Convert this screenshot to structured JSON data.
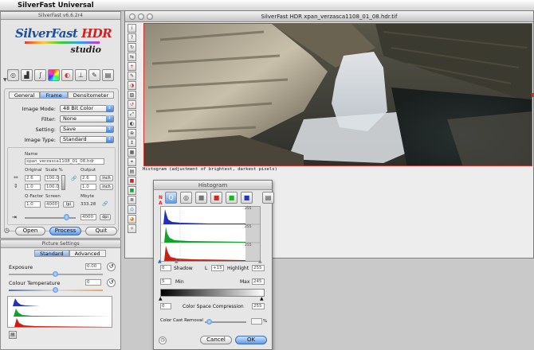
{
  "menubar": {
    "app_name": "SilverFast Universal"
  },
  "palette": {
    "title": "SilverFast v6.6.2r4",
    "logo": {
      "brand": "SilverFast",
      "product": "HDR",
      "edition": "studio"
    },
    "tabs": [
      "General",
      "Frame",
      "Densitometer"
    ],
    "selected_tab": "Frame",
    "image_mode": {
      "label": "Image Mode:",
      "value": "48 Bit Color"
    },
    "filter": {
      "label": "Filter:",
      "value": "None"
    },
    "setting": {
      "label": "Setting:",
      "value": "Save"
    },
    "image_type": {
      "label": "Image Type:",
      "value": "Standard"
    },
    "name_label": "Name",
    "name_value": "xpan_verzasca1108_01_08.hdr",
    "original_label": "Original",
    "scale_label": "Scale %",
    "output_label": "Output",
    "orig_w": "2.6",
    "orig_h": "1.0",
    "scale_w": "100.0",
    "scale_h": "100.0",
    "out_w": "2.6",
    "out_h": "1.0",
    "unit": "inch",
    "qfactor_label": "Q-Factor",
    "screen_label": "Screen",
    "mbyte_label": "Mbyte",
    "qfactor_value": "1.0",
    "screen_value": "4000",
    "screen_unit": "lpi",
    "mbyte_value": "333.28",
    "dpi_value": "4000",
    "dpi_unit": "dpi",
    "open_label": "Open",
    "process_label": "Process",
    "quit_label": "Quit"
  },
  "picture_settings": {
    "title": "Picture Settings",
    "tabs": [
      "Standard",
      "Advanced"
    ],
    "exposure_label": "Exposure",
    "exposure_value": "0.00",
    "color_temp_label": "Colour Temperature",
    "color_temp_value": "0"
  },
  "main_window": {
    "title": "SilverFast HDR xpan_verzasca1108_01_08.hdr.tif",
    "caption": "Histogram (adjustment of brightest, darkest pixels)"
  },
  "histogram_dialog": {
    "title": "Histogram",
    "scale_max": "255",
    "channels": [
      "blue",
      "green",
      "red"
    ],
    "shadow_label": "Shadow",
    "shadow_value": "0",
    "l_label": "L",
    "l_value": "+15",
    "highlight_label": "Highlight",
    "highlight_value": "255",
    "min_label": "Min",
    "min_value": "5",
    "max_label": "Max",
    "max_value": "245",
    "csc_label": "Color Space Compression",
    "csc_low": "0",
    "csc_high": "255",
    "ccr_label": "Color Cast Removal",
    "ccr_unit": "%",
    "cancel_label": "Cancel",
    "ok_label": "OK"
  },
  "colors": {
    "accent": "#3c7fd9",
    "frame_red": "#c83333",
    "histo_blue": "#1f2fbf",
    "histo_green": "#12a22b",
    "histo_red": "#d01e12"
  }
}
